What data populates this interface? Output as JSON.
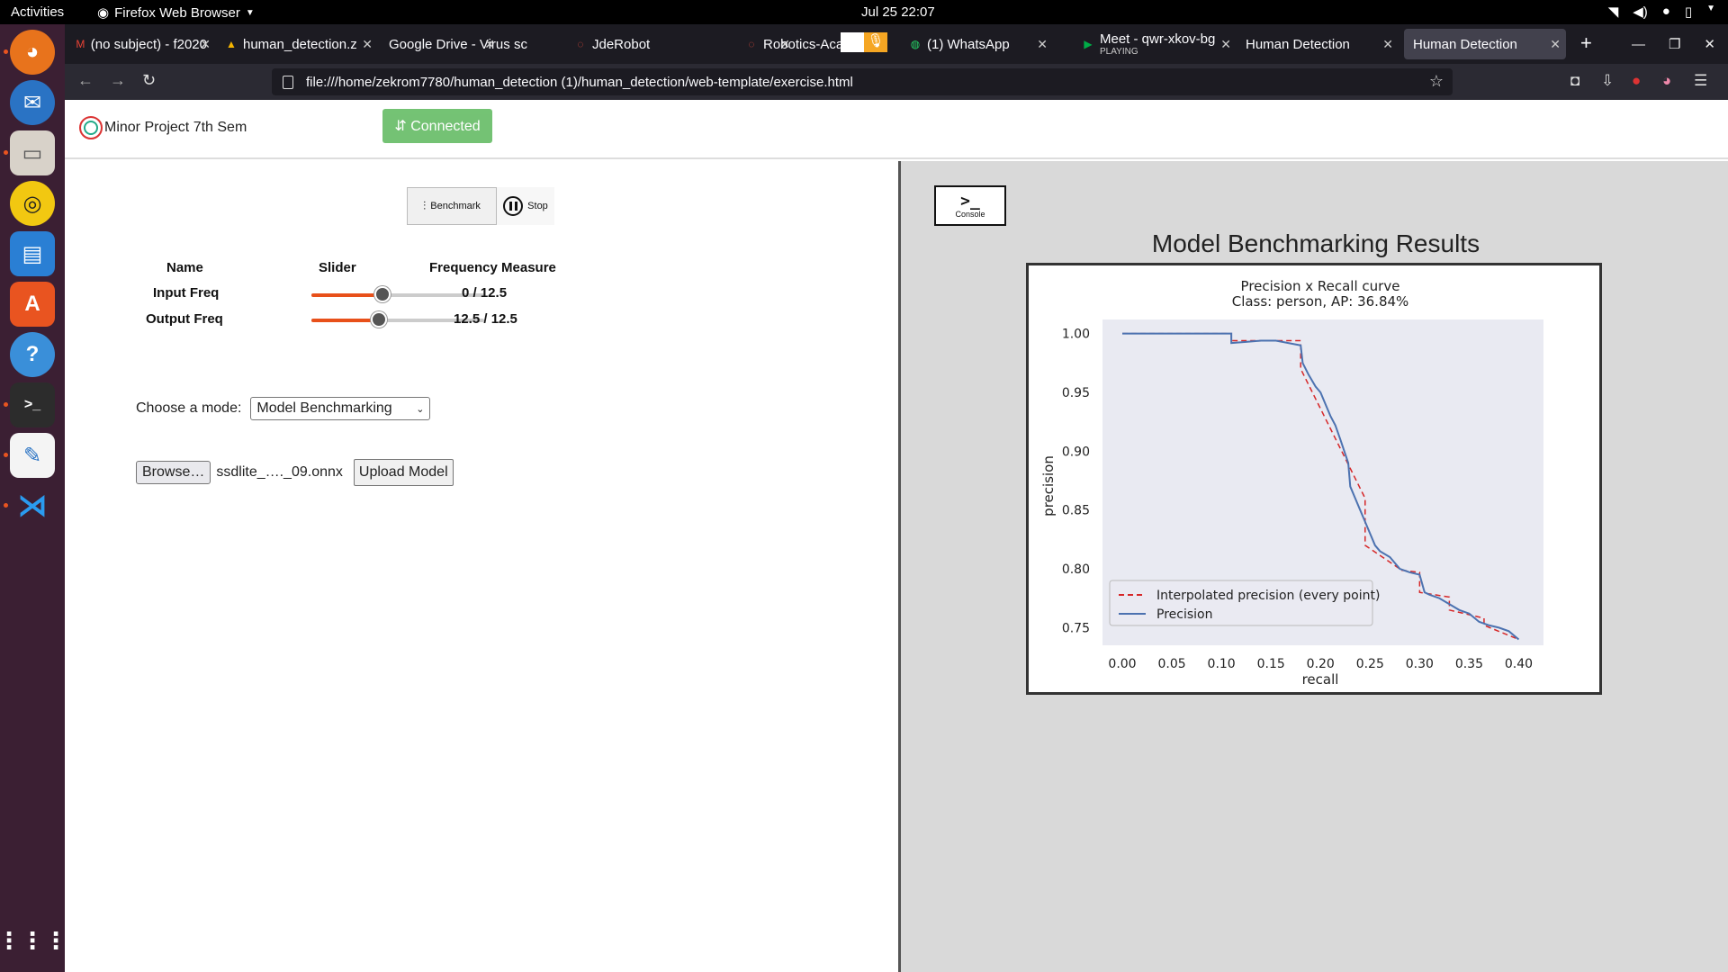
{
  "os": {
    "activities": "Activities",
    "app_name": "Firefox Web Browser",
    "clock": "Jul 25  22:07"
  },
  "browser": {
    "tabs": [
      {
        "label": "(no subject) - f2020",
        "icon": "gmail-icon"
      },
      {
        "label": "human_detection.z",
        "icon": "drive-icon"
      },
      {
        "label": "Google Drive - Virus sc",
        "icon": "none"
      },
      {
        "label": "JdeRobot",
        "icon": "jderobot-icon"
      },
      {
        "label": "Robotics-Aca",
        "icon": "robotics-icon"
      },
      {
        "label": "(1) WhatsApp",
        "icon": "whatsapp-icon"
      },
      {
        "label": "Meet - qwr-xkov-bg",
        "sublabel": "PLAYING",
        "icon": "meet-icon"
      },
      {
        "label": "Human Detection",
        "icon": "none"
      },
      {
        "label": "Human Detection",
        "icon": "none",
        "active": true
      }
    ],
    "url": "file:///home/zekrom7780/human_detection (1)/human_detection/web-template/exercise.html"
  },
  "app": {
    "brand": "Minor Project 7th Sem",
    "connection_status": "⇵ Connected",
    "controls": {
      "benchmark_label": "Benchmark",
      "stop_label": "Stop"
    },
    "freq_table": {
      "headers": [
        "Name",
        "Slider",
        "Frequency Measure"
      ],
      "rows": [
        {
          "name": "Input Freq",
          "slider_fraction": 0.41,
          "measure": "0 / 12.5"
        },
        {
          "name": "Output Freq",
          "slider_fraction": 0.39,
          "measure": "12.5 / 12.5"
        }
      ]
    },
    "mode": {
      "label": "Choose a mode:",
      "selected": "Model Benchmarking"
    },
    "upload": {
      "browse_label": "Browse…",
      "file_name": "ssdlite_…._09.onnx",
      "upload_label": "Upload Model"
    },
    "console_label": "Console",
    "results_title": "Model Benchmarking Results"
  },
  "chart_data": {
    "type": "line",
    "title": "Precision x Recall curve",
    "subtitle": "Class: person, AP: 36.84%",
    "xlabel": "recall",
    "ylabel": "precision",
    "xlim": [
      -0.02,
      0.425
    ],
    "ylim": [
      0.735,
      1.012
    ],
    "xticks": [
      "0.00",
      "0.05",
      "0.10",
      "0.15",
      "0.20",
      "0.25",
      "0.30",
      "0.35",
      "0.40"
    ],
    "yticks": [
      "0.75",
      "0.80",
      "0.85",
      "0.90",
      "0.95",
      "1.00"
    ],
    "legend_position": "bottom-left",
    "series": [
      {
        "name": "Interpolated precision (every point)",
        "color": "#d62728",
        "style": "dashed",
        "x": [
          0.0,
          0.11,
          0.11,
          0.135,
          0.135,
          0.18,
          0.18,
          0.245,
          0.245,
          0.28,
          0.28,
          0.3,
          0.3,
          0.33,
          0.33,
          0.365,
          0.365,
          0.4
        ],
        "y": [
          1.0,
          1.0,
          0.994,
          0.994,
          0.994,
          0.994,
          0.97,
          0.86,
          0.82,
          0.8,
          0.799,
          0.797,
          0.78,
          0.776,
          0.765,
          0.758,
          0.752,
          0.74
        ]
      },
      {
        "name": "Precision",
        "color": "#4c72b0",
        "style": "solid",
        "x": [
          0.0,
          0.11,
          0.11,
          0.125,
          0.14,
          0.155,
          0.18,
          0.182,
          0.188,
          0.195,
          0.2,
          0.205,
          0.21,
          0.215,
          0.22,
          0.228,
          0.23,
          0.235,
          0.24,
          0.245,
          0.25,
          0.255,
          0.26,
          0.27,
          0.28,
          0.29,
          0.3,
          0.305,
          0.31,
          0.32,
          0.33,
          0.34,
          0.35,
          0.36,
          0.37,
          0.38,
          0.39,
          0.4
        ],
        "y": [
          1.0,
          1.0,
          0.992,
          0.993,
          0.994,
          0.994,
          0.99,
          0.975,
          0.965,
          0.955,
          0.95,
          0.94,
          0.93,
          0.922,
          0.91,
          0.89,
          0.87,
          0.86,
          0.85,
          0.84,
          0.83,
          0.82,
          0.815,
          0.81,
          0.8,
          0.797,
          0.795,
          0.78,
          0.778,
          0.775,
          0.77,
          0.765,
          0.762,
          0.755,
          0.752,
          0.75,
          0.747,
          0.74
        ]
      }
    ],
    "background": "#e9eaf2"
  }
}
